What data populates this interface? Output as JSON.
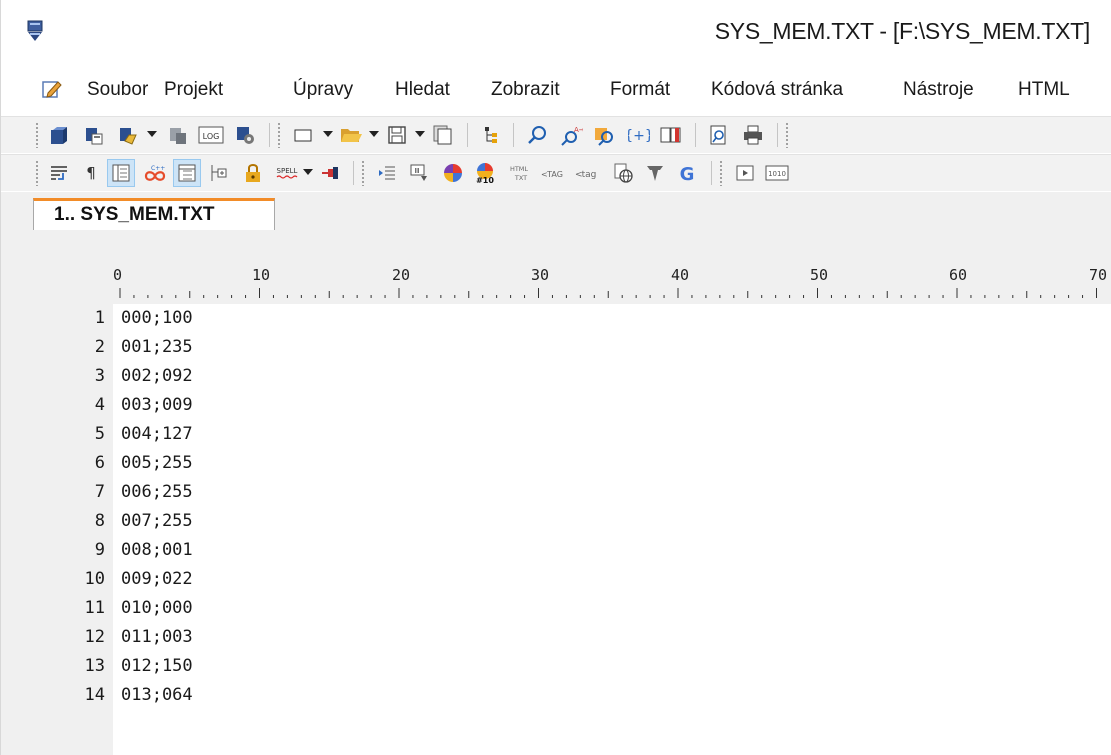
{
  "window": {
    "title": "SYS_MEM.TXT - [F:\\SYS_MEM.TXT]"
  },
  "menu": [
    "Soubor",
    "Projekt",
    "Úpravy",
    "Hledat",
    "Zobrazit",
    "Formát",
    "Kódová stránka",
    "Nástroje",
    "HTML"
  ],
  "toolbar1": {
    "icons": [
      "new-file-icon",
      "new-file-template-icon",
      "new-file-dropdown-icon",
      "copy-file-icon",
      "log-icon",
      "settings-file-icon",
      "new-document-icon",
      "open-folder-icon",
      "save-icon",
      "save-all-icon",
      "project-tree-icon",
      "find-icon",
      "replace-icon",
      "find-in-files-icon",
      "brackets-icon",
      "book-icon",
      "print-preview-icon",
      "print-icon"
    ],
    "log_label": "LOG"
  },
  "toolbar2": {
    "icons": [
      "word-wrap-icon",
      "pilcrow-icon",
      "line-numbers-icon",
      "syntax-highlight-icon",
      "show-ruler-icon",
      "code-folding-icon",
      "lock-icon",
      "spellcheck-icon",
      "bookmark-pin-icon",
      "indent-icon",
      "sort-icon",
      "color-picker-icon",
      "hex-color-icon",
      "html-to-text-icon",
      "tag-upper-icon",
      "tag-lower-icon",
      "web-browser-icon",
      "tortoise-icon",
      "google-icon",
      "play-macro-icon",
      "binary-icon"
    ],
    "spell_label": "SPELL",
    "html_label": "HTML",
    "txt_label": "TXT",
    "tag_upper_label": "TAG",
    "tag_lower_label": "tag",
    "hex_label": "#10",
    "binary_label": "1010",
    "google_label": "G"
  },
  "tab": {
    "label": "1.. SYS_MEM.TXT"
  },
  "ruler": {
    "labels": [
      "0",
      "10",
      "20",
      "30",
      "40",
      "50",
      "60",
      "70"
    ]
  },
  "editor": {
    "lines": [
      {
        "n": "1",
        "text": "000;100"
      },
      {
        "n": "2",
        "text": "001;235"
      },
      {
        "n": "3",
        "text": "002;092"
      },
      {
        "n": "4",
        "text": "003;009"
      },
      {
        "n": "5",
        "text": "004;127"
      },
      {
        "n": "6",
        "text": "005;255"
      },
      {
        "n": "7",
        "text": "006;255"
      },
      {
        "n": "8",
        "text": "007;255"
      },
      {
        "n": "9",
        "text": "008;001"
      },
      {
        "n": "10",
        "text": "009;022"
      },
      {
        "n": "11",
        "text": "010;000"
      },
      {
        "n": "12",
        "text": "011;003"
      },
      {
        "n": "13",
        "text": "012;150"
      },
      {
        "n": "14",
        "text": "013;064"
      }
    ]
  },
  "colors": {
    "tab_accent": "#f28c28",
    "chrome": "#f0f0f0",
    "active_toggle": "#cde4f7"
  }
}
